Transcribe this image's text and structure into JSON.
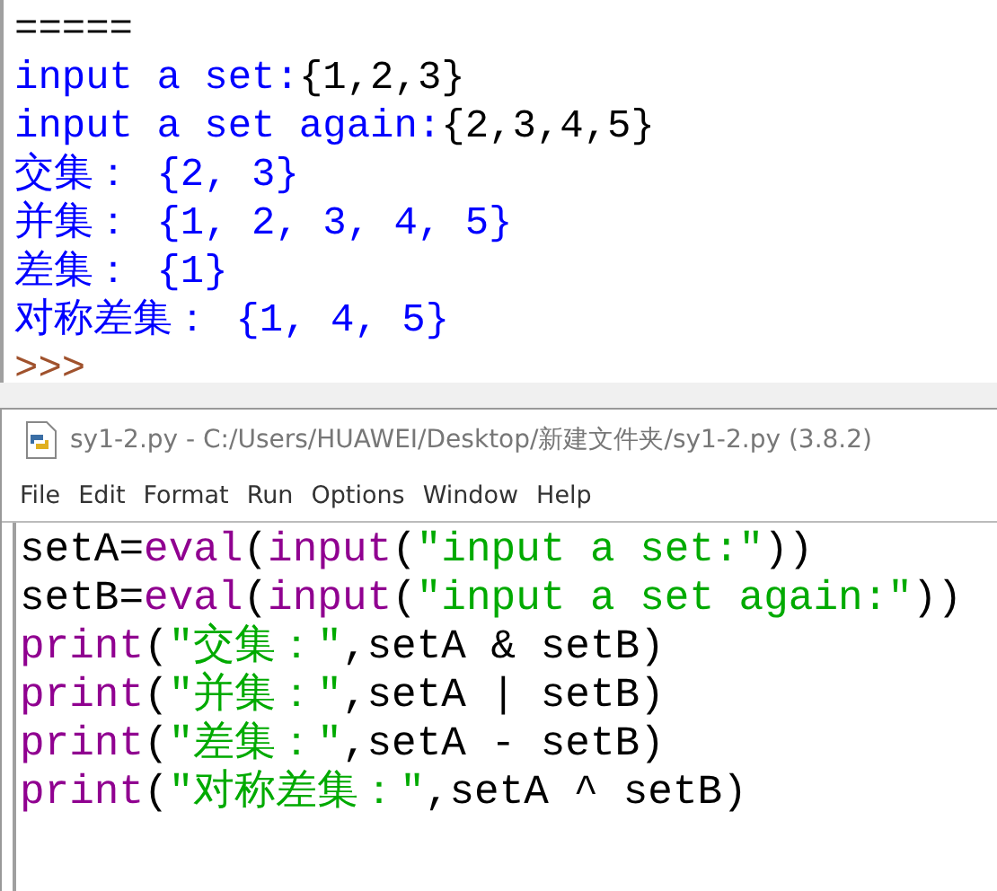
{
  "shell": {
    "lines": [
      [
        {
          "kind": "plain",
          "text": "====="
        }
      ],
      [
        {
          "kind": "stdout",
          "text": "input a set:"
        },
        {
          "kind": "plain",
          "text": "{1,2,3}"
        }
      ],
      [
        {
          "kind": "stdout",
          "text": "input a set again:"
        },
        {
          "kind": "plain",
          "text": "{2,3,4,5}"
        }
      ],
      [
        {
          "kind": "stdout",
          "text": "交集： {2, 3}"
        }
      ],
      [
        {
          "kind": "stdout",
          "text": "并集： {1, 2, 3, 4, 5}"
        }
      ],
      [
        {
          "kind": "stdout",
          "text": "差集： {1}"
        }
      ],
      [
        {
          "kind": "stdout",
          "text": "对称差集： {1, 4, 5}"
        }
      ]
    ],
    "prompt": ">>>"
  },
  "editor": {
    "window": {
      "title": "sy1-2.py - C:/Users/HUAWEI/Desktop/新建文件夹/sy1-2.py (3.8.2)"
    },
    "menu": [
      "File",
      "Edit",
      "Format",
      "Run",
      "Options",
      "Window",
      "Help"
    ],
    "code": [
      [
        {
          "kind": "plain",
          "text": "setA="
        },
        {
          "kind": "builtin",
          "text": "eval"
        },
        {
          "kind": "plain",
          "text": "("
        },
        {
          "kind": "builtin",
          "text": "input"
        },
        {
          "kind": "plain",
          "text": "("
        },
        {
          "kind": "string",
          "text": "\"input a set:\""
        },
        {
          "kind": "plain",
          "text": "))"
        }
      ],
      [
        {
          "kind": "plain",
          "text": "setB="
        },
        {
          "kind": "builtin",
          "text": "eval"
        },
        {
          "kind": "plain",
          "text": "("
        },
        {
          "kind": "builtin",
          "text": "input"
        },
        {
          "kind": "plain",
          "text": "("
        },
        {
          "kind": "string",
          "text": "\"input a set again:\""
        },
        {
          "kind": "plain",
          "text": "))"
        }
      ],
      [
        {
          "kind": "builtin",
          "text": "print"
        },
        {
          "kind": "plain",
          "text": "("
        },
        {
          "kind": "string",
          "text": "\"交集：\""
        },
        {
          "kind": "plain",
          "text": ",setA & setB)"
        }
      ],
      [
        {
          "kind": "builtin",
          "text": "print"
        },
        {
          "kind": "plain",
          "text": "("
        },
        {
          "kind": "string",
          "text": "\"并集：\""
        },
        {
          "kind": "plain",
          "text": ",setA | setB)"
        }
      ],
      [
        {
          "kind": "builtin",
          "text": "print"
        },
        {
          "kind": "plain",
          "text": "("
        },
        {
          "kind": "string",
          "text": "\"差集：\""
        },
        {
          "kind": "plain",
          "text": ",setA - setB)"
        }
      ],
      [
        {
          "kind": "builtin",
          "text": "print"
        },
        {
          "kind": "plain",
          "text": "("
        },
        {
          "kind": "string",
          "text": "\"对称差集：\""
        },
        {
          "kind": "plain",
          "text": ",setA ^ setB)"
        }
      ]
    ]
  }
}
